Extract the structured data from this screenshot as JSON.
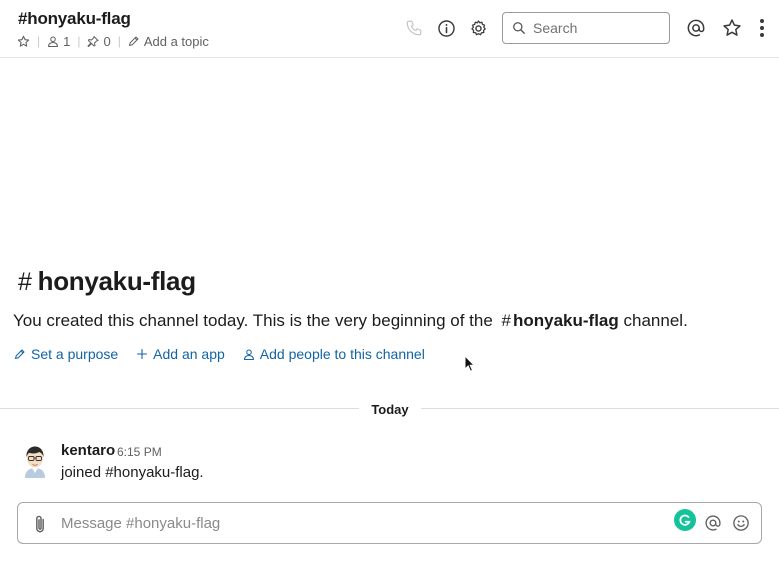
{
  "header": {
    "channel_name": "#honyaku-flag",
    "member_count": "1",
    "pinned_count": "0",
    "add_topic_label": "Add a topic",
    "search_placeholder": "Search"
  },
  "intro": {
    "hash": "#",
    "title": "honyaku-flag",
    "text_before": "You created this channel today. This is the very beginning of the",
    "channel_hash": "#",
    "channel_name": "honyaku-flag",
    "text_after": "channel."
  },
  "actions": [
    {
      "label": "Set a purpose",
      "icon": "pencil-icon"
    },
    {
      "label": "Add an app",
      "icon": "plus-icon"
    },
    {
      "label": "Add people to this channel",
      "icon": "person-icon"
    }
  ],
  "divider": {
    "label": "Today"
  },
  "message": {
    "author": "kentaro",
    "time": "6:15 PM",
    "text": "joined #honyaku-flag."
  },
  "composer": {
    "placeholder": "Message #honyaku-flag"
  },
  "colors": {
    "link": "#1264a3",
    "text": "#1d1c1d",
    "muted": "#616061",
    "grammarly": "#15c39a"
  },
  "icons": [
    "star-icon",
    "person-icon",
    "pin-icon",
    "pencil-icon",
    "phone-icon",
    "info-icon",
    "gear-icon",
    "search-icon",
    "at-icon",
    "star-icon",
    "more-vertical-icon",
    "paperclip-icon",
    "grammarly-icon",
    "emoji-icon"
  ]
}
